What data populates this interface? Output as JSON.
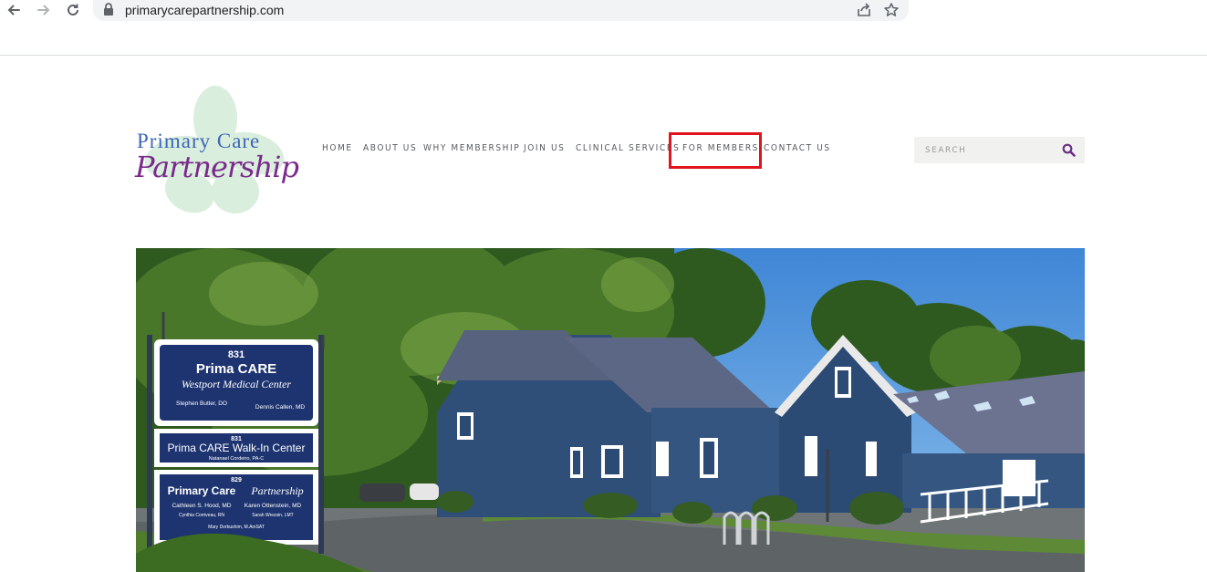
{
  "browser": {
    "url": "primarycarepartnership.com",
    "icons": {
      "back": "arrow-left-icon",
      "forward": "arrow-right-icon",
      "reload": "reload-icon",
      "secure": "lock-icon",
      "share": "share-icon",
      "bookmark": "star-icon"
    }
  },
  "logo": {
    "line1": "Primary Care",
    "line2": "Partnership"
  },
  "nav": {
    "items": [
      {
        "label": "HOME"
      },
      {
        "label": "ABOUT US"
      },
      {
        "label": "WHY MEMBERSHIP"
      },
      {
        "label": "JOIN US"
      },
      {
        "label": "CLINICAL SERVICES"
      },
      {
        "label": "FOR MEMBERS"
      },
      {
        "label": "CONTACT US"
      }
    ],
    "highlighted": "FOR MEMBERS"
  },
  "search": {
    "placeholder": "SEARCH",
    "icon": "search-icon"
  },
  "hero": {
    "sign": {
      "panel1": {
        "number": "831",
        "brand": "Prima CARE",
        "name": "Westport Medical Center",
        "left_name": "Stephen Butler, DO",
        "right_name": "Dennis Callen, MD"
      },
      "panel2": {
        "number": "831",
        "title": "Prima CARE Walk-In Center",
        "sub": "Natanael Cordeiro, PA-C"
      },
      "panel3": {
        "number": "829",
        "brand": "Primary Care",
        "script": "Partnership",
        "name1": "Cathleen S. Hood, MD",
        "name2": "Karen Ottenstein, MD",
        "name3": "Cynthia Corriveau, RN",
        "name4": "Sarah Wrezsin, LMT",
        "name5": "Mary Dorbushim, M.AmSAT"
      }
    }
  },
  "colors": {
    "accent_highlight": "#e0141c",
    "logo_blue": "#3d66b5",
    "logo_purple": "#7a2a8c",
    "nav_text": "#555a60",
    "search_bg": "#f1f1ef"
  }
}
